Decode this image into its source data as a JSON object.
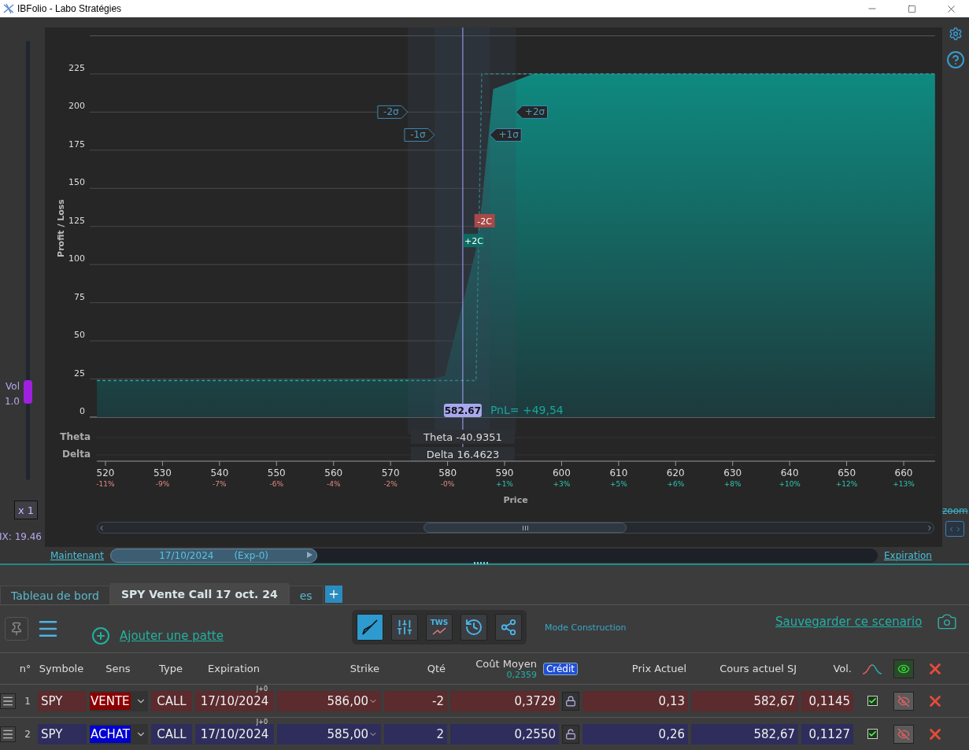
{
  "window": {
    "title": "IBFolio - Labo Stratégies"
  },
  "side_panel": {
    "vol_label": "Vol",
    "vol_factor": "1.0",
    "vol_slider": {
      "level": 0.2
    },
    "multiplier": "x 1",
    "vix": "IX: 19.46"
  },
  "chart": {
    "chart_data": {
      "type": "area",
      "ylabel": "Profit / Loss",
      "xlabel": "Price",
      "grid": true,
      "x": [
        518.5,
        577,
        579.5,
        585,
        586,
        588,
        595,
        665.5
      ],
      "series": [
        {
          "color": "#0f8a80",
          "values": [
            24,
            25,
            27,
            110,
            140,
            215,
            225,
            225
          ]
        },
        {
          "type": "line",
          "line_style": "dashed",
          "color": "#2aa6a0",
          "values": [
            24,
            24,
            24,
            24,
            225,
            225,
            225,
            225
          ]
        }
      ],
      "xlim": [
        518.5,
        665.5
      ],
      "ylim": [
        0,
        250
      ],
      "xticks": [
        520,
        530,
        540,
        550,
        560,
        570,
        580,
        590,
        600,
        610,
        620,
        630,
        640,
        650,
        660
      ],
      "yticks": [
        0,
        25,
        50,
        75,
        100,
        125,
        150,
        175,
        200,
        225
      ],
      "bands": [
        {
          "axis": "x",
          "from": 573,
          "to": 592
        },
        {
          "axis": "x",
          "from": 577.7,
          "to": 587.4
        }
      ],
      "ref_lines": [
        {
          "axis": "x",
          "value": 582.67
        }
      ],
      "annotations": [
        "-2σ",
        "+2σ",
        "-1σ",
        "+1σ",
        "-2C",
        "+2C",
        "582.67",
        "PnL= +49,54"
      ]
    },
    "price_changes": [
      {
        "text": "-11%",
        "kind": "down"
      },
      {
        "text": "-9%",
        "kind": "down"
      },
      {
        "text": "-7%",
        "kind": "down"
      },
      {
        "text": "-6%",
        "kind": "down"
      },
      {
        "text": "-4%",
        "kind": "down"
      },
      {
        "text": "-2%",
        "kind": "down"
      },
      {
        "text": "-0%",
        "kind": "down"
      },
      {
        "text": "+1%",
        "kind": "up"
      },
      {
        "text": "+3%",
        "kind": "up"
      },
      {
        "text": "+5%",
        "kind": "up"
      },
      {
        "text": "+6%",
        "kind": "up"
      },
      {
        "text": "+8%",
        "kind": "up"
      },
      {
        "text": "+10%",
        "kind": "up"
      },
      {
        "text": "+12%",
        "kind": "up"
      },
      {
        "text": "+13%",
        "kind": "up"
      }
    ],
    "greeks": [
      {
        "label": "Theta",
        "reading": "Theta -40.9351"
      },
      {
        "label": "Delta",
        "reading": "Delta 16.4623"
      }
    ]
  },
  "zoom": {
    "label": "zoom"
  },
  "timeline": {
    "start_link": "Maintenant",
    "date": "17/10/2024",
    "offset": "(Exp-0)",
    "level": 0.27,
    "end_link": "Expiration"
  },
  "tabs": [
    {
      "label": "Tableau de bord",
      "selected": false
    },
    {
      "label": "SPY Vente Call 17 oct. 24",
      "selected": true
    },
    {
      "label": "es",
      "selected": false
    }
  ],
  "toolbar": {
    "add_leg": "Ajouter une patte",
    "modes": [
      {
        "kind": "build",
        "selected": true
      },
      {
        "kind": "sliders",
        "selected": false
      },
      {
        "kind": "tws",
        "label": "TWS",
        "selected": false
      },
      {
        "kind": "history",
        "selected": false
      },
      {
        "kind": "share",
        "selected": false
      }
    ],
    "mode_label": "Mode Construction",
    "save_link": "Sauvegarder ce scenario"
  },
  "table": {
    "columns": [
      "n°",
      "Symbole",
      "Sens",
      "Type",
      "Expiration",
      "Strike",
      "Qté",
      "Coût Moyen",
      "Prix Actuel",
      "Cours actuel SJ",
      "Vol."
    ],
    "cost_average": "0,2359",
    "credit_badge": "Crédit",
    "rows": [
      {
        "n": "1",
        "symbol": "SPY",
        "kind": "sell",
        "side": "VENTE",
        "type": "CALL",
        "expiry_tag": "J+0",
        "expiration": "17/10/2024",
        "strike": "586,00",
        "qty": "-2",
        "cost": "0,3729",
        "locked": true,
        "price": "0,13",
        "underlying": "582,67",
        "vol": "0,1145",
        "checked": true,
        "visible": false
      },
      {
        "n": "2",
        "symbol": "SPY",
        "kind": "buy",
        "side": "ACHAT",
        "type": "CALL",
        "expiry_tag": "J+0",
        "expiration": "17/10/2024",
        "strike": "585,00",
        "qty": "2",
        "cost": "0,2550",
        "locked": false,
        "price": "0,26",
        "underlying": "582,67",
        "vol": "0,1127",
        "checked": true,
        "visible": false
      }
    ]
  }
}
